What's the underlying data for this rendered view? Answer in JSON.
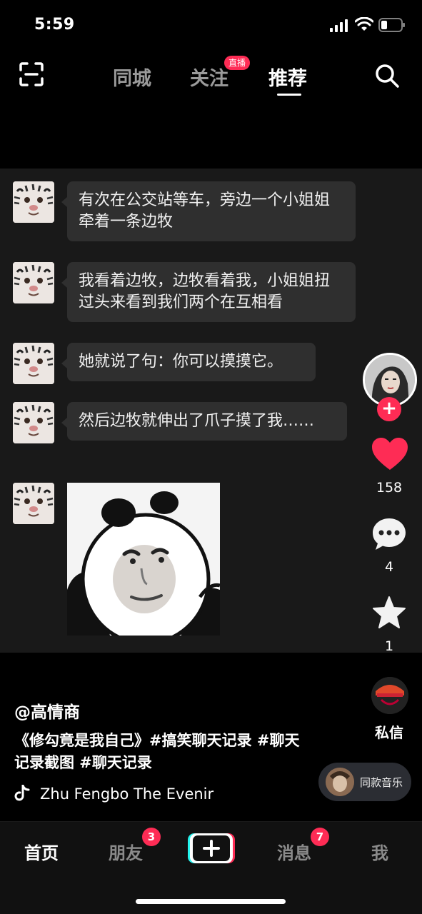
{
  "status_bar": {
    "time": "5:59"
  },
  "top_nav": {
    "tabs": [
      {
        "label": "同城"
      },
      {
        "label": "关注"
      },
      {
        "label": "推荐"
      }
    ],
    "live_badge": "直播",
    "active_tab": "推荐"
  },
  "chat": {
    "messages": [
      {
        "text": "有次在公交站等车，旁边一个小姐姐牵着一条边牧"
      },
      {
        "text": "我看着边牧，边牧看着我，小姐姐扭过头来看到我们两个在互相看"
      },
      {
        "text": "她就说了句：你可以摸摸它。"
      },
      {
        "text": "然后边牧就伸出了爪子摸了我……"
      }
    ]
  },
  "actions": {
    "like_count": "158",
    "comment_count": "4",
    "favorite_count": "1",
    "dm_label": "私信"
  },
  "caption": {
    "author": "@高情商",
    "text": "《修勾竟是我自己》#搞笑聊天记录 #聊天记录截图 #聊天记录",
    "music": "Zhu Fengbo    The Evenir"
  },
  "same_music": {
    "label": "同款音乐"
  },
  "bottom_tabs": {
    "home": "首页",
    "friends": "朋友",
    "friends_badge": "3",
    "messages": "消息",
    "messages_badge": "7",
    "me": "我"
  },
  "colors": {
    "accent": "#fe2c55",
    "bubble": "#2f2f2f",
    "video_bg": "#191919"
  }
}
